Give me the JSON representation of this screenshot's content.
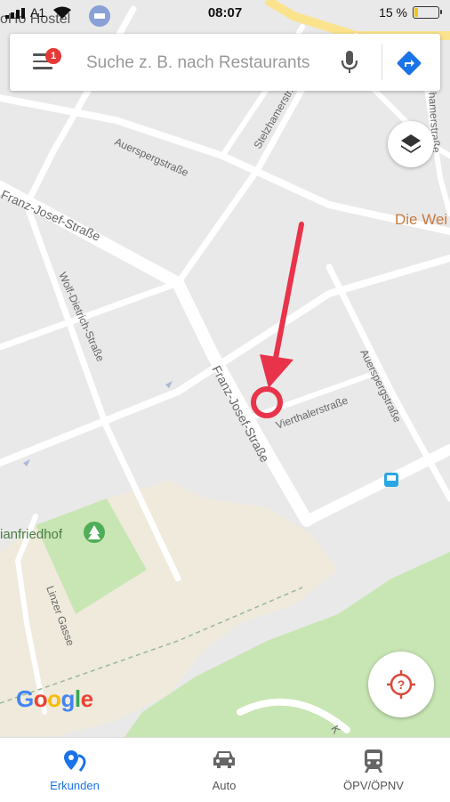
{
  "status_bar": {
    "carrier": "A1",
    "time": "08:07",
    "battery_percent": "15 %",
    "battery_level": 0.15
  },
  "search": {
    "placeholder": "Suche z. B. nach Restaurants",
    "notification_count": "1"
  },
  "map": {
    "streets": {
      "franz_josef_1": "Franz-Josef-Straße",
      "franz_josef_2": "Franz-Josef-Straße",
      "auerspergstrasse_top": "Auerspergstraße",
      "auerspergstrasse_right": "Auerspergstraße",
      "stelzhamerstrasse": "Stelzhamerstr.",
      "hamerstrasse": "hamerstraße",
      "wolf_dietrich": "Wolf-Dietrich-Straße",
      "vierthalerstrasse": "Vierthalerstraße",
      "linzer_gasse": "Linzer Gasse",
      "k_label": "K"
    },
    "places": {
      "hostel": "oHo Hostel",
      "friedhof": "ianfriedhof",
      "die_wei": "Die Wei"
    },
    "colors": {
      "annotation": "#e8334a",
      "park": "#c8e6b4",
      "building": "#efeadc",
      "road": "#ffffff",
      "background": "#e9e9e9"
    }
  },
  "logo": {
    "letters": [
      "G",
      "o",
      "o",
      "g",
      "l",
      "e"
    ]
  },
  "bottom_nav": {
    "items": [
      {
        "label": "Erkunden",
        "icon": "explore-pin-icon",
        "active": true
      },
      {
        "label": "Auto",
        "icon": "car-icon",
        "active": false
      },
      {
        "label": "ÖPV/ÖPNV",
        "icon": "train-icon",
        "active": false
      }
    ]
  }
}
